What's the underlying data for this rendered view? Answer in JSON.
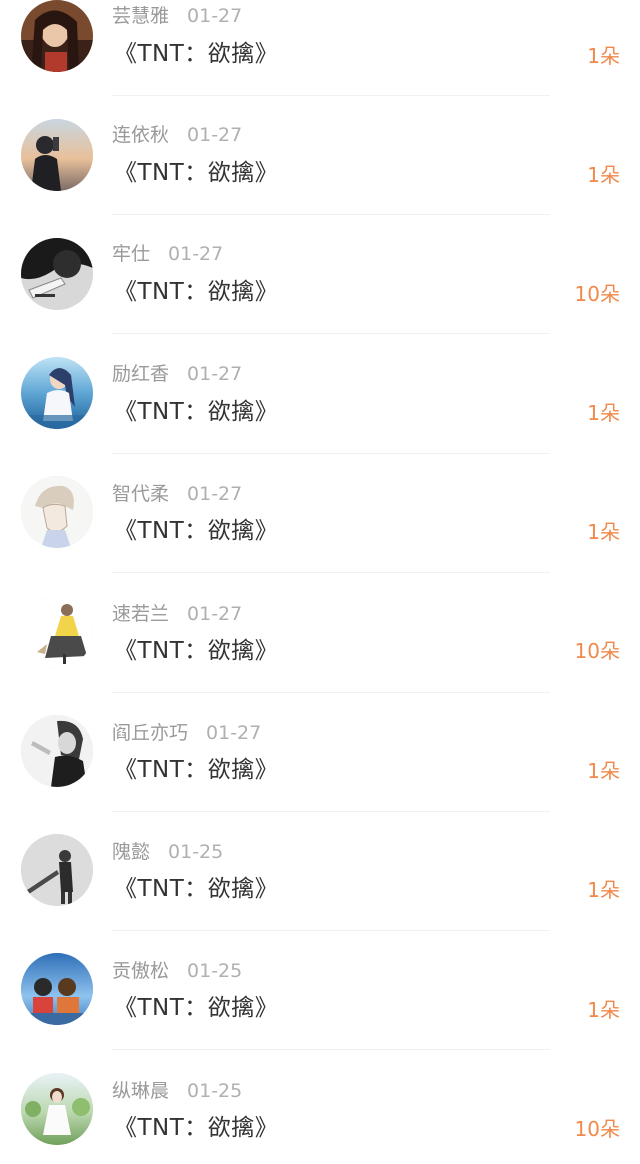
{
  "gifts": [
    {
      "name": "芸慧雅",
      "date": "01-27",
      "title": "《TNT：欲擒》",
      "amount": "1朵",
      "avatar": "avatar-dark-hair"
    },
    {
      "name": "连依秋",
      "date": "01-27",
      "title": "《TNT：欲擒》",
      "amount": "1朵",
      "avatar": "avatar-sunset-photo"
    },
    {
      "name": "牢仕",
      "date": "01-27",
      "title": "《TNT：欲擒》",
      "amount": "10朵",
      "avatar": "avatar-monochrome"
    },
    {
      "name": "励红香",
      "date": "01-27",
      "title": "《TNT：欲擒》",
      "amount": "1朵",
      "avatar": "avatar-ocean-anime"
    },
    {
      "name": "智代柔",
      "date": "01-27",
      "title": "《TNT：欲擒》",
      "amount": "1朵",
      "avatar": "avatar-sketch-boy"
    },
    {
      "name": "速若兰",
      "date": "01-27",
      "title": "《TNT：欲擒》",
      "amount": "10朵",
      "avatar": "avatar-figure-yellow"
    },
    {
      "name": "阎丘亦巧",
      "date": "01-27",
      "title": "《TNT：欲擒》",
      "amount": "1朵",
      "avatar": "avatar-bw-woman"
    },
    {
      "name": "隗懿",
      "date": "01-25",
      "title": "《TNT：欲擒》",
      "amount": "1朵",
      "avatar": "avatar-grey-figure"
    },
    {
      "name": "贡傲松",
      "date": "01-25",
      "title": "《TNT：欲擒》",
      "amount": "1朵",
      "avatar": "avatar-sky-cartoon"
    },
    {
      "name": "纵琳晨",
      "date": "01-25",
      "title": "《TNT：欲擒》",
      "amount": "10朵",
      "avatar": "avatar-garden-girl"
    }
  ],
  "colors": {
    "name": "#9a9a9a",
    "title": "#333333",
    "amount": "#f0894a"
  }
}
